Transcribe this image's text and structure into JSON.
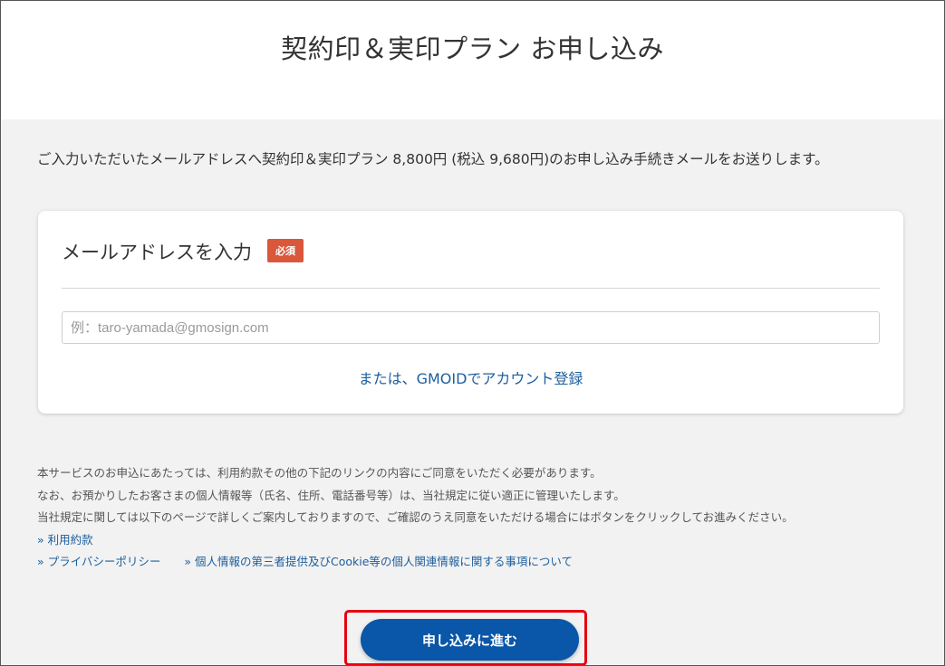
{
  "header": {
    "title": "契約印＆実印プラン お申し込み"
  },
  "intro": {
    "text": "ご入力いただいたメールアドレスへ契約印＆実印プラン 8,800円 (税込 9,680円)のお申し込み手続きメールをお送りします。"
  },
  "email_card": {
    "title": "メールアドレスを入力",
    "required_badge": "必須",
    "input_value": "",
    "input_placeholder": "例：taro-yamada@gmosign.com",
    "gmoid_link": "または、GMOIDでアカウント登録"
  },
  "terms": {
    "line1": "本サービスのお申込にあたっては、利用約款その他の下記のリンクの内容にご同意をいただく必要があります。",
    "line2": "なお、お預かりしたお客さまの個人情報等（氏名、住所、電話番号等）は、当社規定に従い適正に管理いたします。",
    "line3": "当社規定に関しては以下のページで詳しくご案内しておりますので、ご確認のうえ同意をいただける場合にはボタンをクリックしてお進みください。",
    "links": [
      "» 利用約款",
      "» プライバシーポリシー",
      "» 個人情報の第三者提供及びCookie等の個人関連情報に関する事項について"
    ]
  },
  "submit": {
    "label": "申し込みに進む"
  },
  "colors": {
    "accent": "#0a56a8",
    "link": "#1d5e9c",
    "required": "#d9573b",
    "highlight_border": "#e60012",
    "background": "#f2f2f2"
  }
}
